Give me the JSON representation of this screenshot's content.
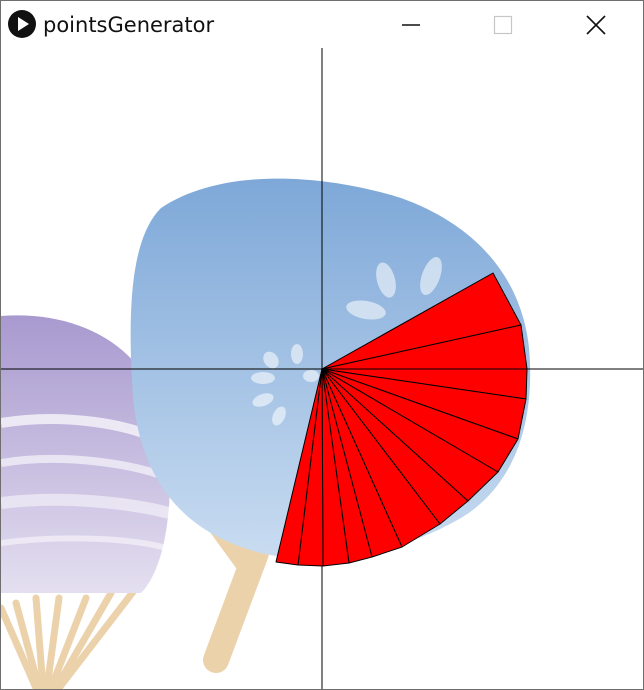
{
  "window": {
    "title": "pointsGenerator",
    "buttons": {
      "minimize": "minimize-icon",
      "maximize": "maximize-icon",
      "close": "close-icon"
    }
  },
  "canvas": {
    "background_image": "uchiwa-fans-illustration",
    "axis_color": "#000000",
    "fan_fill": "#ff0000",
    "fan_stroke": "#000000",
    "fan_segment_count": 13
  }
}
